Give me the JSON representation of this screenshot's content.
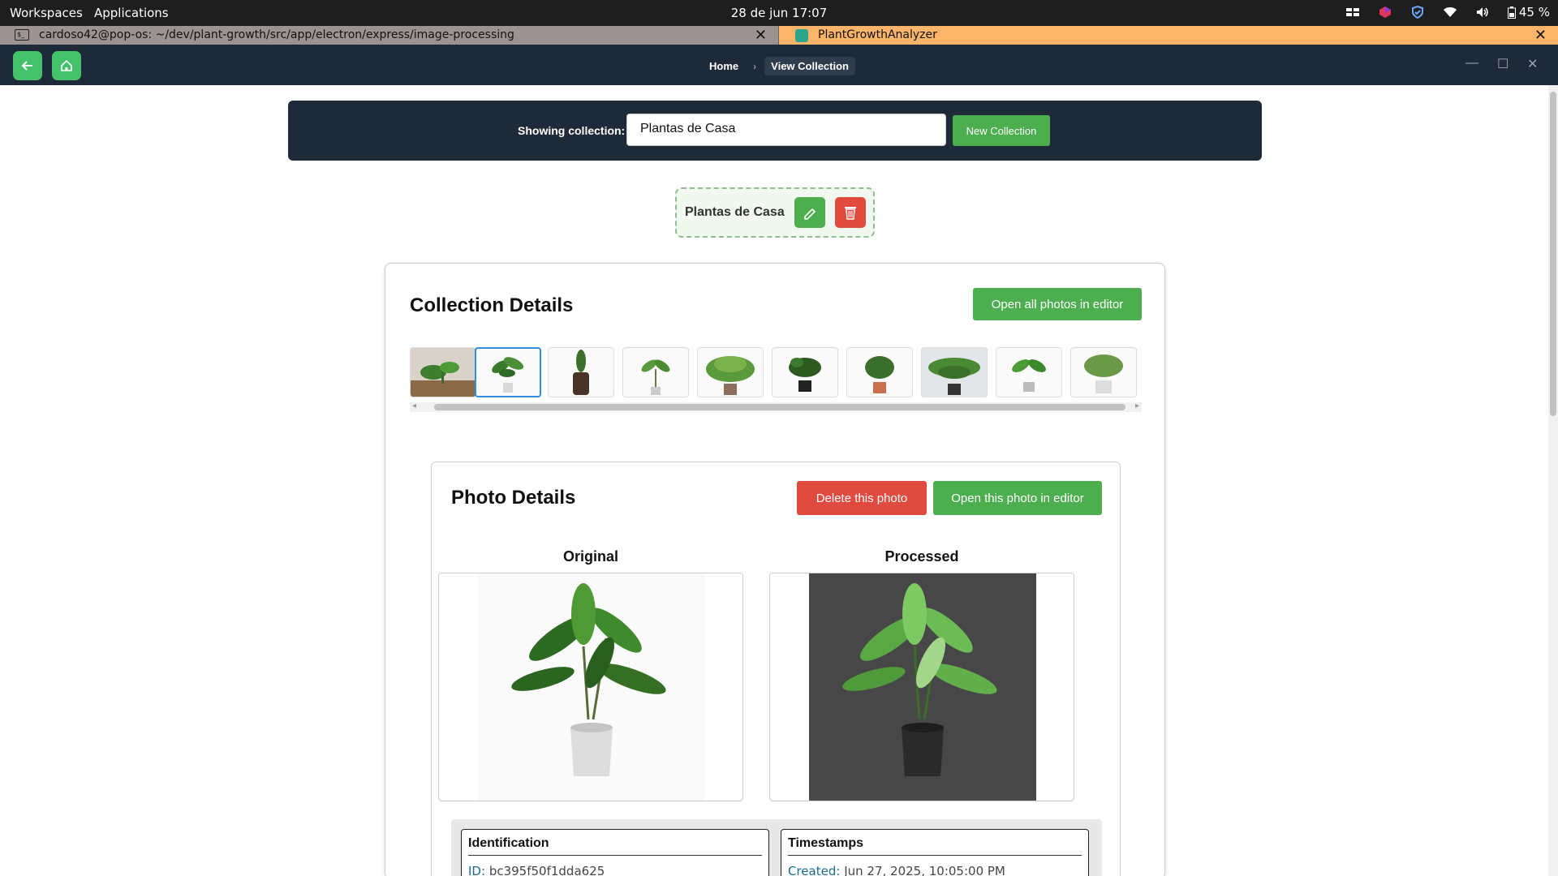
{
  "system": {
    "workspaces": "Workspaces",
    "applications": "Applications",
    "clock": "28 de jun  17:07",
    "battery": "45 %"
  },
  "tabs": [
    {
      "title": "cardoso42@pop-os: ~/dev/plant-growth/src/app/electron/express/image-processing"
    },
    {
      "title": "PlantGrowthAnalyzer"
    }
  ],
  "header": {
    "breadcrumb": [
      {
        "label": "Home"
      },
      {
        "label": "View Collection"
      }
    ]
  },
  "collection_bar": {
    "label": "Showing collection:",
    "selected": "Plantas de Casa",
    "new_button": "New Collection"
  },
  "collection_chip": {
    "name": "Plantas de Casa"
  },
  "details": {
    "title": "Collection Details",
    "open_all": "Open all photos in editor",
    "selected_thumbnail": 2
  },
  "photo": {
    "title": "Photo Details",
    "delete": "Delete this photo",
    "open": "Open this photo in editor",
    "original_label": "Original",
    "processed_label": "Processed"
  },
  "identification": {
    "title": "Identification",
    "id_key": "ID:",
    "id_value": "bc395f50f1dda625"
  },
  "timestamps": {
    "title": "Timestamps",
    "created_key": "Created:",
    "created_value": "Jun 27, 2025, 10:05:00 PM"
  },
  "colors": {
    "accent_green": "#4cae4f",
    "danger_red": "#e04a3f",
    "header_navy": "#1f2a38",
    "selected_blue": "#2f8fe0"
  }
}
